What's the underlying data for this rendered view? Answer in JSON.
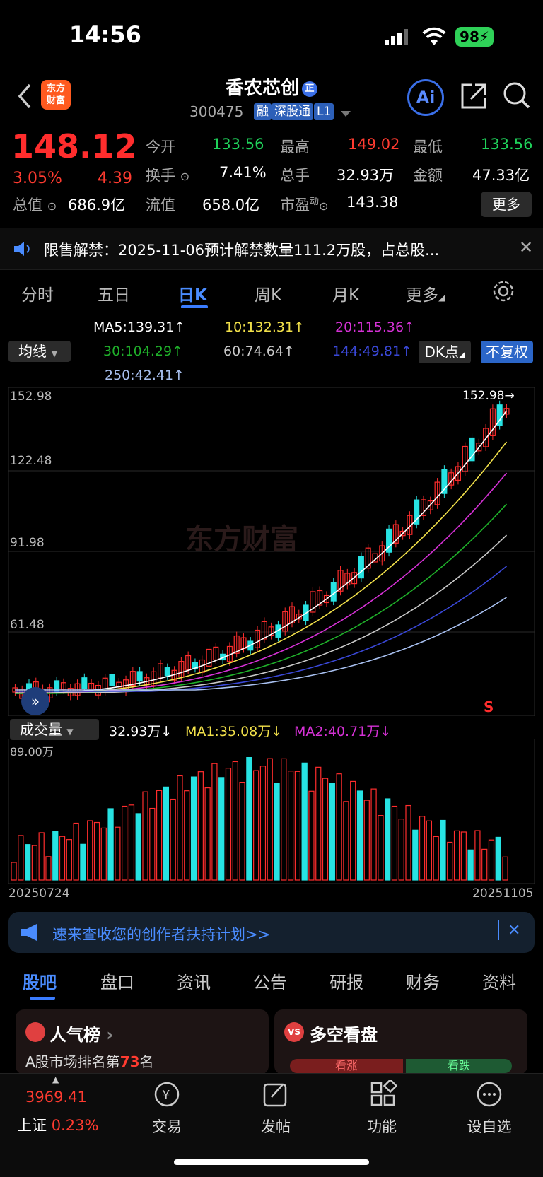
{
  "status": {
    "time": "14:56",
    "battery": "98"
  },
  "header": {
    "logo_line1": "东方",
    "logo_line2": "财富",
    "name": "香农芯创",
    "name_badge": "正",
    "code": "300475",
    "tags": [
      "融",
      "深股通",
      "L1"
    ]
  },
  "quote": {
    "price": "148.12",
    "change_pct": "3.05%",
    "change": "4.39",
    "open_label": "今开",
    "open": "133.56",
    "high_label": "最高",
    "high": "149.02",
    "low_label": "最低",
    "low": "133.56",
    "turnover_label": "换手",
    "turnover": "7.41%",
    "volume_label": "总手",
    "volume": "32.93万",
    "amount_label": "金额",
    "amount": "47.33亿",
    "mktcap_label": "总值",
    "mktcap": "686.9亿",
    "float_label": "流值",
    "float_cap": "658.0亿",
    "pe_label": "市盈",
    "pe_sup": "动",
    "pe": "143.38",
    "more": "更多"
  },
  "notice": {
    "text": "限售解禁：2025-11-06预计解禁数量111.2万股，占总股..."
  },
  "tabs": [
    "分时",
    "五日",
    "日K",
    "周K",
    "月K",
    "更多"
  ],
  "active_tab": "日K",
  "ma": {
    "selector": "均线",
    "ma5": "MA5:139.31↑",
    "ma10": "10:132.31↑",
    "ma20": "20:115.36↑",
    "ma30": "30:104.29↑",
    "ma60": "60:74.64↑",
    "ma144": "144:49.81↑",
    "ma250": "250:42.41↑",
    "dk": "DK点",
    "fuquan": "不复权",
    "colors": {
      "ma5": "#ffffff",
      "ma10": "#f2e14a",
      "ma20": "#d631d6",
      "ma30": "#1fb02a",
      "ma60": "#c9c9c9",
      "ma144": "#3a48d8",
      "ma250": "#a8c0f0"
    }
  },
  "kline": {
    "y_labels": [
      "152.98",
      "122.48",
      "91.98",
      "61.48"
    ],
    "max_label": "152.98→",
    "watermark": "东方财富",
    "signal_s": "S"
  },
  "volume": {
    "selector": "成交量",
    "vol": "32.93万↓",
    "ma1": "MA1:35.08万↓",
    "ma2": "MA2:40.71万↓",
    "y_max": "89.00万",
    "date_start": "20250724",
    "date_end": "20251105"
  },
  "banner": {
    "text": "速来查收您的创作者扶持计划>>"
  },
  "bottom_tabs": [
    "股吧",
    "盘口",
    "资讯",
    "公告",
    "研报",
    "财务",
    "资料"
  ],
  "cards": {
    "rank_title": "人气榜",
    "rank_text_prefix": "A股市场排名第",
    "rank_num": "73",
    "rank_suffix": "名",
    "ls_title": "多空看盘",
    "ls_up": "看涨",
    "ls_down": "看跌"
  },
  "bottom_nav": {
    "index_value": "3969.41",
    "index_name": "上证",
    "index_pct": "0.23%",
    "items": [
      "交易",
      "发帖",
      "功能",
      "设自选"
    ]
  }
}
